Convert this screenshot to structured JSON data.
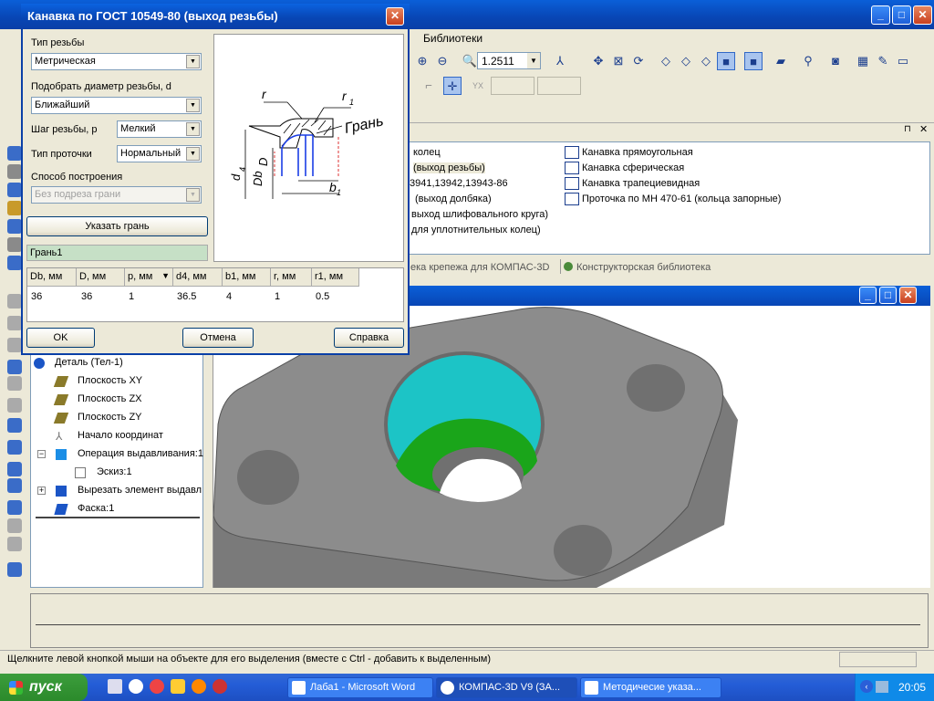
{
  "main_window": {
    "menu": {
      "libraries": "Библиотеки"
    },
    "zoom_value": "1.2511"
  },
  "library_panel": {
    "left_column": [
      "колец",
      "(выход резьбы)",
      "3941,13942,13943-86",
      "(выход долбяка)",
      "выход шлифовального круга)",
      "для уплотнительных колец)"
    ],
    "right_column": [
      "Канавка прямоугольная",
      "Канавка сферическая",
      "Канавка трапециевидная",
      "Проточка по МН 470-61 (кольца запорные)"
    ],
    "tabs": [
      "ека крепежа для КОМПАС-3D",
      "Конструкторская библиотека"
    ]
  },
  "tree": {
    "items": [
      "Деталь (Тел-1)",
      "Плоскость XY",
      "Плоскость ZX",
      "Плоскость ZY",
      "Начало координат",
      "Операция выдавливания:1",
      "Эскиз:1",
      "Вырезать элемент выдавл",
      "Фаска:1"
    ]
  },
  "status_bar": {
    "text": "Щелкните левой кнопкой мыши на объекте для его выделения (вместе с Ctrl - добавить к выделенным)"
  },
  "taskbar": {
    "start": "пуск",
    "buttons": [
      "Лаба1 - Microsoft Word",
      "КОМПАС-3D V9 (ЗА...",
      "Методичесие указа..."
    ],
    "clock": "20:05"
  },
  "dialog": {
    "title": "Канавка по ГОСТ 10549-80 (выход резьбы)",
    "thread_type_label": "Тип резьбы",
    "thread_type_value": "Метрическая",
    "diameter_label": "Подобрать диаметр резьбы, d",
    "diameter_value": "Ближайший",
    "pitch_label": "Шаг резьбы, p",
    "pitch_value": "Мелкий",
    "groove_type_label": "Тип проточки",
    "groove_type_value": "Нормальный",
    "method_label": "Способ построения",
    "method_value": "Без подреза грани",
    "select_face_button": "Указать грань",
    "face_value": "Грань1",
    "sketch_labels": {
      "r": "r",
      "r1": "r",
      "r1_sub": "1",
      "face": "Грань",
      "d4": "d",
      "d4_sub": "4",
      "db": "Db",
      "d": "D",
      "b1": "b",
      "b1_sub": "1"
    },
    "table": {
      "headers": [
        "Db, мм",
        "D, мм",
        "p, мм",
        "d4, мм",
        "b1, мм",
        "r, мм",
        "r1, мм"
      ],
      "row": [
        "36",
        "36",
        "1",
        "36.5",
        "4",
        "1",
        "0.5"
      ]
    },
    "ok": "OK",
    "cancel": "Отмена",
    "help": "Справка"
  }
}
